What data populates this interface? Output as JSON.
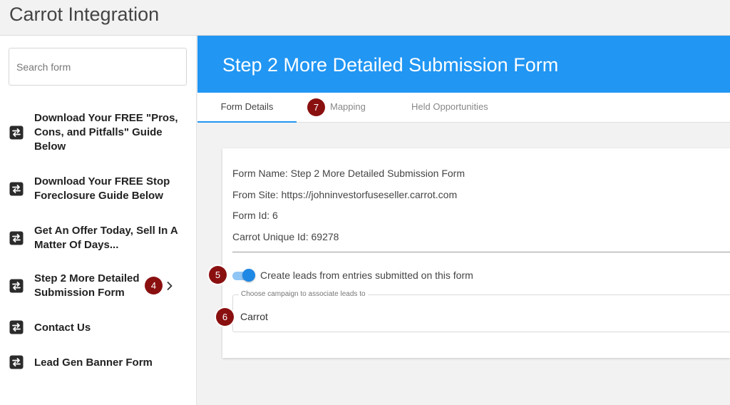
{
  "app": {
    "title": "Carrot Integration"
  },
  "search": {
    "placeholder": "Search form"
  },
  "sidebar": {
    "items": [
      {
        "label": "Download Your FREE \"Pros, Cons, and Pitfalls\" Guide Below"
      },
      {
        "label": "Download Your FREE Stop Foreclosure Guide Below"
      },
      {
        "label": "Get An Offer Today, Sell In A Matter Of Days..."
      },
      {
        "label": "Step 2 More Detailed Submission Form",
        "selected": true
      },
      {
        "label": "Contact Us"
      },
      {
        "label": "Lead Gen Banner Form"
      }
    ],
    "item_icon": "form-swap-icon",
    "selected_indicator_icon": "chevron-right-icon"
  },
  "main": {
    "header_title": "Step 2 More Detailed Submission Form",
    "tabs": [
      {
        "label": "Form Details",
        "active": true
      },
      {
        "label": "Mapping"
      },
      {
        "label": "Held Opportunities"
      }
    ],
    "details": {
      "form_name": "Form Name: Step 2 More Detailed Submission Form",
      "from_site": "From Site: https://johninvestorfuseseller.carrot.com",
      "form_id": "Form Id: 6",
      "carrot_unique_id": "Carrot Unique Id: 69278"
    },
    "toggle": {
      "label": "Create leads from entries submitted on this form",
      "checked": true
    },
    "campaign_select": {
      "legend": "Choose campaign to associate leads to",
      "value": "Carrot"
    }
  },
  "annotations": {
    "badge_4": "4",
    "badge_5": "5",
    "badge_6": "6",
    "badge_7": "7"
  },
  "colors": {
    "accent": "#2196f3",
    "badge": "#8a1010",
    "toggle_thumb": "#1e88e5",
    "toggle_track": "#90c6f5"
  }
}
